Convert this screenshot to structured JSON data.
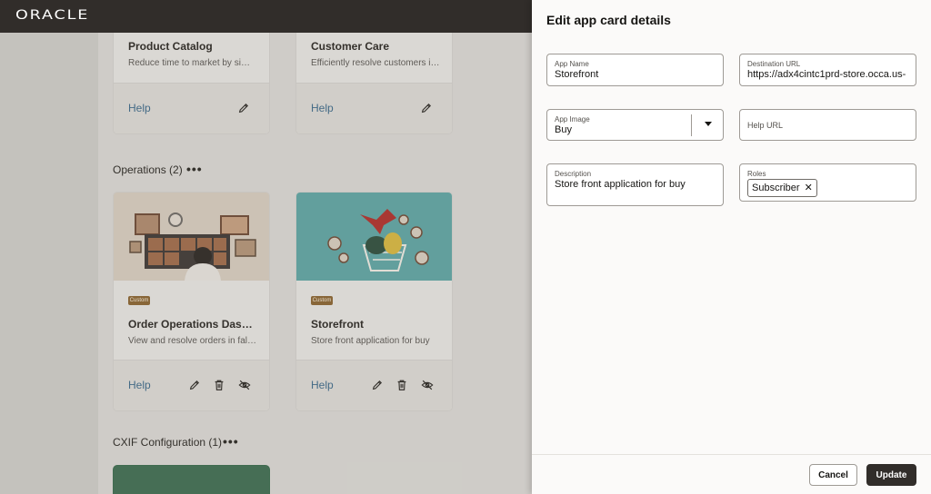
{
  "header": {
    "logo": "ORACLE"
  },
  "cards_top": [
    {
      "title": "Product Catalog",
      "description": "Reduce time to market by simp…",
      "help": "Help"
    },
    {
      "title": "Customer Care",
      "description": "Efficiently resolve customers in…",
      "help": "Help"
    }
  ],
  "sections": [
    {
      "title": "Operations (2)",
      "more": "•••"
    },
    {
      "title": "CXIF Configuration (1)",
      "more": "•••"
    }
  ],
  "cards_ops": [
    {
      "badge": "Custom",
      "title": "Order Operations Dashb…",
      "description": "View and resolve orders in fallout",
      "help": "Help"
    },
    {
      "badge": "Custom",
      "title": "Storefront",
      "description": "Store front application for buy",
      "help": "Help"
    }
  ],
  "panel": {
    "title": "Edit app card details",
    "app_name": {
      "label": "App Name",
      "value": "Storefront"
    },
    "destination_url": {
      "label": "Destination URL",
      "value": "https://adx4cintc1prd-store.occa.us-"
    },
    "app_image": {
      "label": "App Image",
      "value": "Buy"
    },
    "help_url": {
      "placeholder": "Help URL"
    },
    "description": {
      "label": "Description",
      "value": "Store front application for buy"
    },
    "roles": {
      "label": "Roles",
      "chips": [
        "Subscriber"
      ],
      "remove_glyph": "✕"
    },
    "buttons": {
      "cancel": "Cancel",
      "update": "Update"
    }
  },
  "colors": {
    "header_bg": "#312d2a",
    "primary_button": "#312d2a",
    "badge": "#8a6532",
    "link": "#3d6a8a"
  }
}
